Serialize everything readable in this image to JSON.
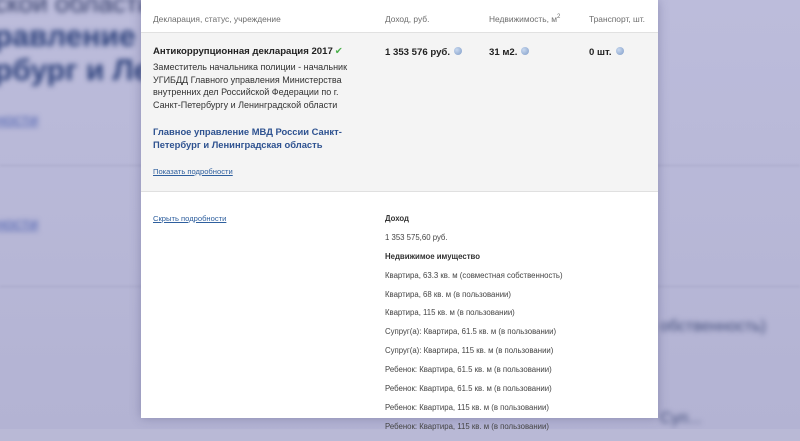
{
  "background": {
    "line1": "ской области",
    "line2": "равление МВД",
    "line3": "рбург и Лени",
    "link1": "ности",
    "link2": "ности",
    "text1": "обственность)",
    "text2": "Суп..."
  },
  "table_header": {
    "declaration": "Декларация, статус, учреждение",
    "income": "Доход, руб.",
    "property": "Недвижимость, м",
    "property_sup": "2",
    "transport": "Транспорт, шт."
  },
  "summary": {
    "title": "Антикоррупционная декларация 2017",
    "check_icon": "✔",
    "position": "Заместитель начальника полиции - начальник УГИБДД Главного управления Министерства внутренних дел Российской Федерации по г. Санкт-Петербургу и Ленинградской области",
    "department": "Главное управление МВД России Санкт-Петербург и Ленинградская область",
    "show_details": "Показать подробности",
    "income": "1 353 576 руб.",
    "property": "31 м2.",
    "transport": "0 шт."
  },
  "details": {
    "hide_details": "Скрыть подробности",
    "income_label": "Доход",
    "income_value": "1 353 575,60 руб.",
    "realty_label": "Недвижимое имущество",
    "items": [
      "Квартира, 63.3 кв. м (совместная собственность)",
      "Квартира, 68 кв. м (в пользовании)",
      "Квартира, 115 кв. м (в пользовании)",
      "Супруг(а): Квартира, 61.5 кв. м (в пользовании)",
      "Супруг(а): Квартира, 115 кв. м (в пользовании)",
      "Ребенок: Квартира, 61.5 кв. м (в пользовании)",
      "Ребенок: Квартира, 61.5 кв. м (в пользовании)",
      "Ребенок: Квартира, 115 кв. м (в пользовании)",
      "Ребенок: Квартира, 115 кв. м (в пользовании)"
    ]
  },
  "icons": {
    "info": "info-icon",
    "check": "check-icon"
  },
  "colors": {
    "link": "#2e5f9e",
    "department": "#2e5290",
    "check": "#4ab04a",
    "summary_bg": "#f4f4f4",
    "overlay_bg": "#b9b9d6"
  }
}
